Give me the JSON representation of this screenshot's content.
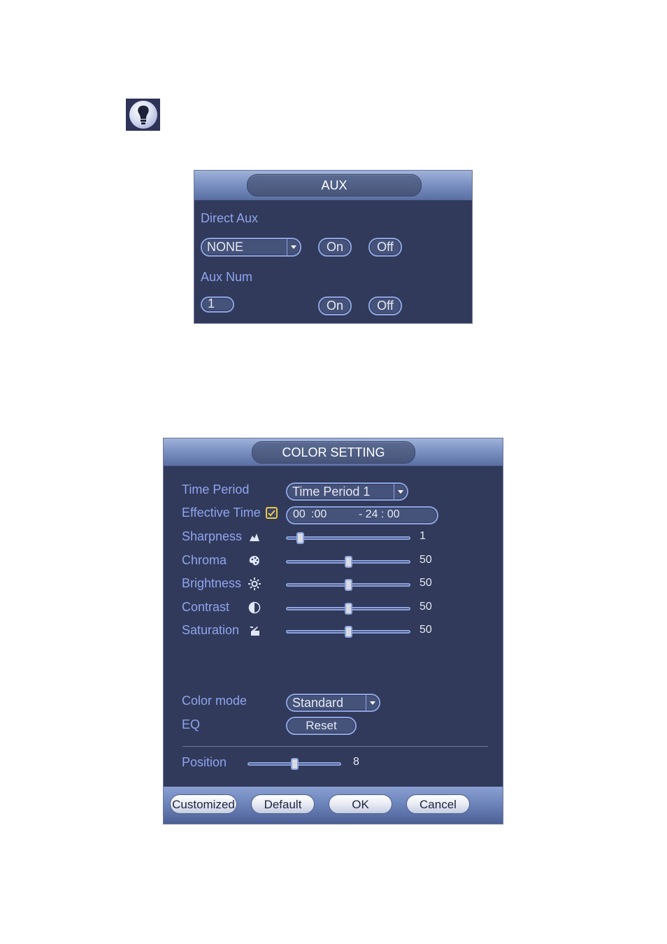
{
  "tip": {
    "icon": "lightbulb-icon"
  },
  "aux": {
    "title": "AUX",
    "direct_aux_label": "Direct Aux",
    "direct_aux_value": "NONE",
    "direct_on": "On",
    "direct_off": "Off",
    "aux_num_label": "Aux Num",
    "aux_num_value": "1",
    "num_on": "On",
    "num_off": "Off"
  },
  "color": {
    "title": "COLOR SETTING",
    "time_period_label": "Time Period",
    "time_period_value": "Time Period 1",
    "effective_time_label": "Effective Time",
    "effective_checked": true,
    "time_start_h": "00",
    "time_start_m": ":00",
    "time_sep": "- 24",
    "time_end_m": ": 00",
    "sliders": [
      {
        "label": "Sharpness",
        "icon": "sharpness-icon",
        "value": "1",
        "fraction": 0.09
      },
      {
        "label": "Chroma",
        "icon": "palette-icon",
        "value": "50",
        "fraction": 0.5
      },
      {
        "label": "Brightness",
        "icon": "sun-icon",
        "value": "50",
        "fraction": 0.5
      },
      {
        "label": "Contrast",
        "icon": "contrast-icon",
        "value": "50",
        "fraction": 0.5
      },
      {
        "label": "Saturation",
        "icon": "saturation-icon",
        "value": "50",
        "fraction": 0.5
      }
    ],
    "color_mode_label": "Color mode",
    "color_mode_value": "Standard",
    "eq_label": "EQ",
    "reset_label": "Reset",
    "position_label": "Position",
    "position_value": "8",
    "position_fraction": 0.5,
    "buttons": {
      "customized": "Customized",
      "default": "Default",
      "ok": "OK",
      "cancel": "Cancel"
    }
  }
}
